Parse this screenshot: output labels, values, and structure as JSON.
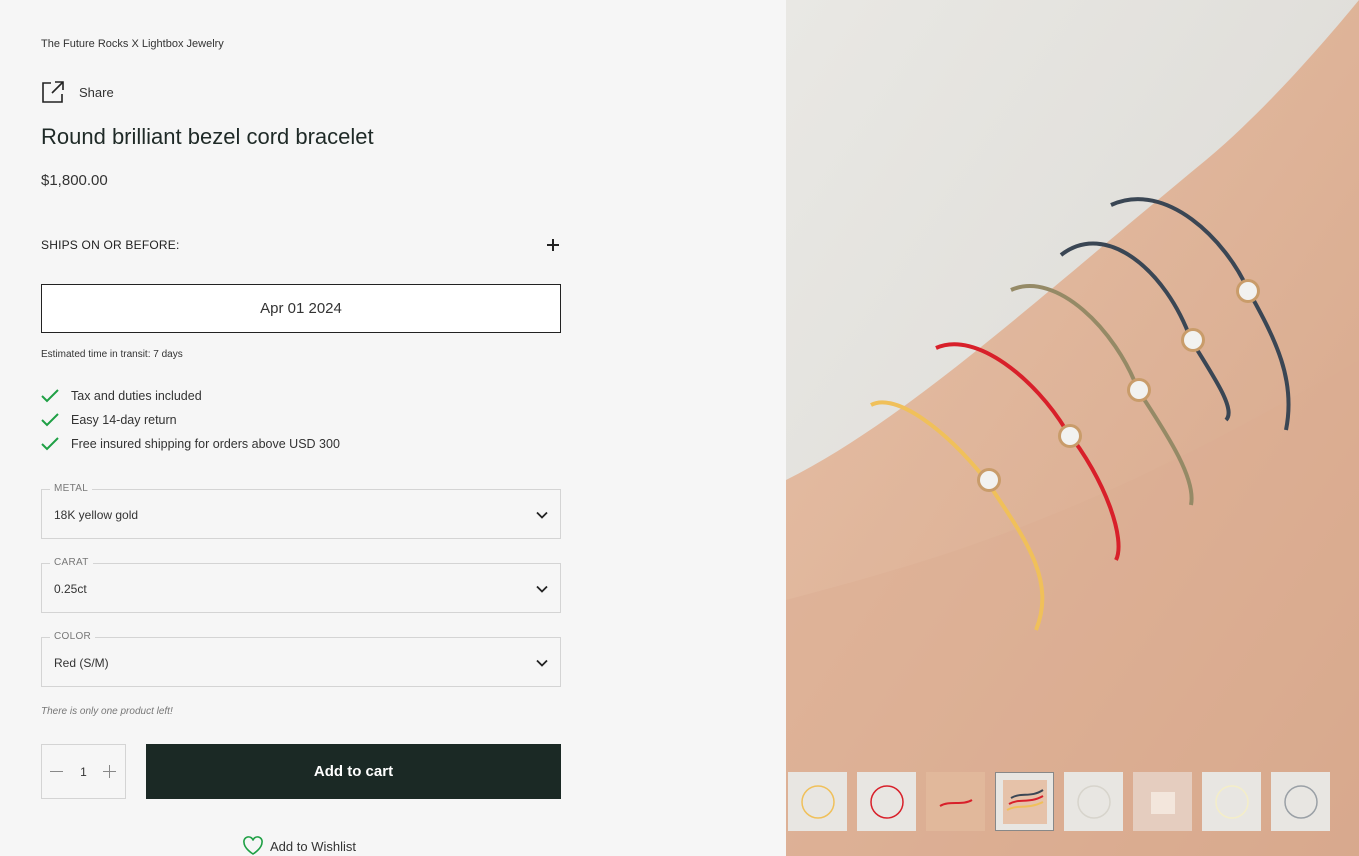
{
  "brand": "The Future Rocks X Lightbox Jewelry",
  "share_label": "Share",
  "product": {
    "title": "Round brilliant bezel cord bracelet",
    "price": "$1,800.00"
  },
  "shipping": {
    "label": "SHIPS ON OR BEFORE:",
    "date": "Apr 01 2024",
    "transit": "Estimated time in transit: 7 days"
  },
  "features": [
    "Tax and duties included",
    "Easy 14-day return",
    "Free insured shipping for orders above USD 300"
  ],
  "options": {
    "metal": {
      "label": "METAL",
      "value": "18K yellow gold"
    },
    "carat": {
      "label": "CARAT",
      "value": "0.25ct"
    },
    "color": {
      "label": "COLOR",
      "value": "Red (S/M)"
    }
  },
  "stock_note": "There is only one product left!",
  "quantity": "1",
  "add_to_cart": "Add to cart",
  "wishlist": "Add to Wishlist",
  "colors": {
    "check": "#1fa045",
    "button_bg": "#1b2925",
    "cords": [
      "#f0c05a",
      "#d8202a",
      "#958a66",
      "#3a4654"
    ]
  },
  "thumbnails": [
    "cord-yellow",
    "cord-red",
    "wrist-red",
    "wrist-stack",
    "cord-white",
    "packaging",
    "cord-gold",
    "cord-grey"
  ]
}
